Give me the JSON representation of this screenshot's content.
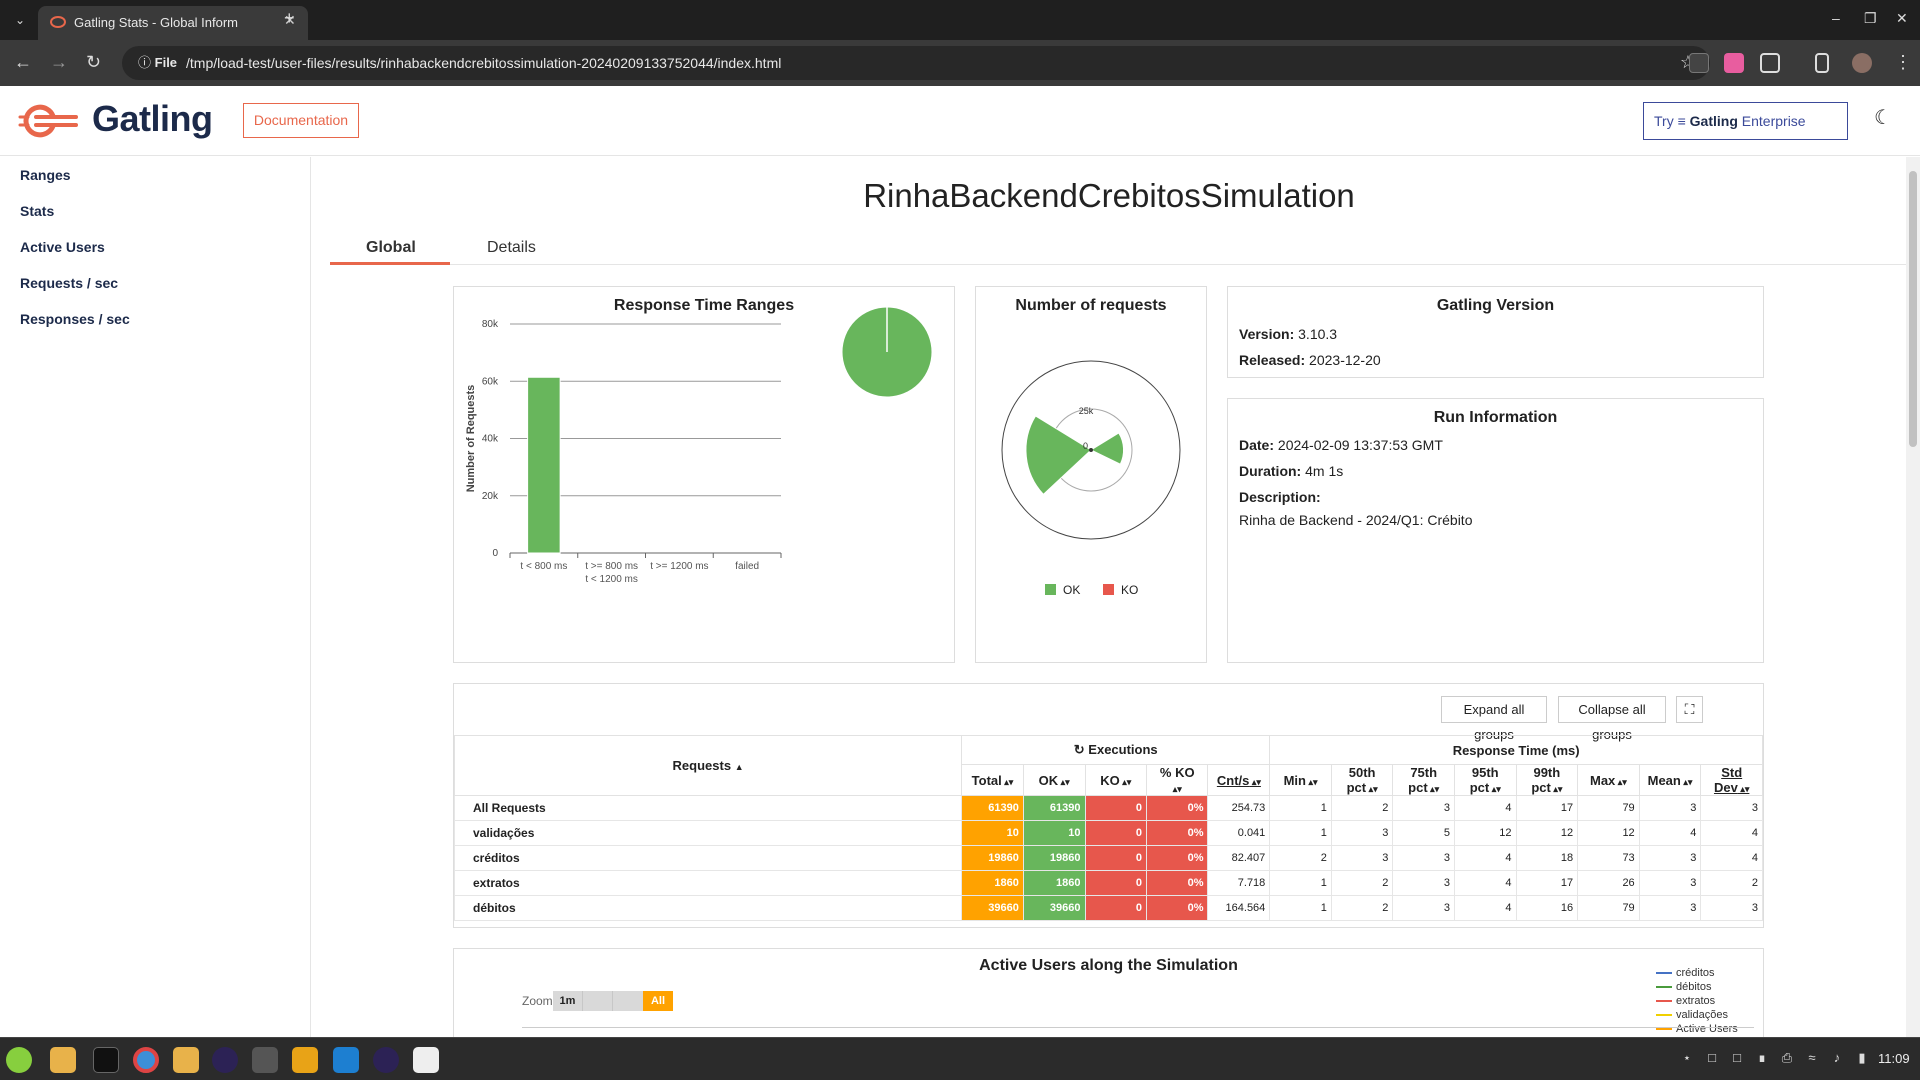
{
  "browser": {
    "tab_title": "Gatling Stats - Global Inform",
    "file_label": "File",
    "url": "/tmp/load-test/user-files/results/rinhabackendcrebitossimulation-20240209133752044/index.html",
    "icons": [
      "tab-menu-icon",
      "close-icon",
      "new-tab-icon",
      "back-icon",
      "forward-icon",
      "reload-icon",
      "info-icon",
      "star-icon",
      "extensions-icon",
      "sidebar-icon",
      "profile-avatar",
      "menu-icon"
    ]
  },
  "header": {
    "logo_text": "Gatling",
    "documentation_label": "Documentation",
    "enterprise_try": "Try",
    "enterprise_brand": "Gatling",
    "enterprise_suffix": "Enterprise"
  },
  "sidebar": {
    "items": [
      {
        "label": "Ranges"
      },
      {
        "label": "Stats"
      },
      {
        "label": "Active Users"
      },
      {
        "label": "Requests / sec"
      },
      {
        "label": "Responses / sec"
      }
    ]
  },
  "main": {
    "title": "RinhaBackendCrebitosSimulation",
    "tabs": [
      {
        "label": "Global"
      },
      {
        "label": "Details"
      }
    ]
  },
  "ranges_panel": {
    "title": "Response Time Ranges"
  },
  "requests_panel": {
    "title": "Number of requests",
    "legend_ok": "OK",
    "legend_ko": "KO"
  },
  "version_panel": {
    "title": "Gatling Version",
    "version_label": "Version:",
    "version": "3.10.3",
    "released_label": "Released:",
    "released": "2023-12-20"
  },
  "run_panel": {
    "title": "Run Information",
    "date_label": "Date:",
    "date": "2024-02-09 13:37:53 GMT",
    "duration_label": "Duration:",
    "duration": "4m 1s",
    "description_label": "Description:",
    "description": "Rinha de Backend - 2024/Q1: Crébito"
  },
  "stats_table": {
    "expand_label": "Expand all groups",
    "collapse_label": "Collapse all groups",
    "requests_header": "Requests",
    "executions_header": "Executions",
    "response_time_header": "Response Time (ms)",
    "columns": [
      "Total",
      "OK",
      "KO",
      "% KO",
      "Cnt/s",
      "Min",
      "50th pct",
      "75th pct",
      "95th pct",
      "99th pct",
      "Max",
      "Mean",
      "Std Dev"
    ],
    "col_split": {
      "pct_ko": [
        "% KO"
      ],
      "p50": [
        "50th",
        "pct"
      ],
      "p75": [
        "75th",
        "pct"
      ],
      "p95": [
        "95th",
        "pct"
      ],
      "p99": [
        "99th",
        "pct"
      ],
      "std": [
        "Std",
        "Dev"
      ]
    },
    "rows": [
      {
        "name": "All Requests",
        "total": "61390",
        "ok": "61390",
        "ko": "0",
        "pct_ko": "0%",
        "cnt": "254.73",
        "min": "1",
        "p50": "2",
        "p75": "3",
        "p95": "4",
        "p99": "17",
        "max": "79",
        "mean": "3",
        "std": "3"
      },
      {
        "name": "validações",
        "total": "10",
        "ok": "10",
        "ko": "0",
        "pct_ko": "0%",
        "cnt": "0.041",
        "min": "1",
        "p50": "3",
        "p75": "5",
        "p95": "12",
        "p99": "12",
        "max": "12",
        "mean": "4",
        "std": "4"
      },
      {
        "name": "créditos",
        "total": "19860",
        "ok": "19860",
        "ko": "0",
        "pct_ko": "0%",
        "cnt": "82.407",
        "min": "2",
        "p50": "3",
        "p75": "3",
        "p95": "4",
        "p99": "18",
        "max": "73",
        "mean": "3",
        "std": "4"
      },
      {
        "name": "extratos",
        "total": "1860",
        "ok": "1860",
        "ko": "0",
        "pct_ko": "0%",
        "cnt": "7.718",
        "min": "1",
        "p50": "2",
        "p75": "3",
        "p95": "4",
        "p99": "17",
        "max": "26",
        "mean": "3",
        "std": "2"
      },
      {
        "name": "débitos",
        "total": "39660",
        "ok": "39660",
        "ko": "0",
        "pct_ko": "0%",
        "cnt": "164.564",
        "min": "1",
        "p50": "2",
        "p75": "3",
        "p95": "4",
        "p99": "16",
        "max": "79",
        "mean": "3",
        "std": "3"
      }
    ]
  },
  "users_panel": {
    "title": "Active Users along the Simulation",
    "zoom_label": "Zoom",
    "zoom_options": [
      "1m",
      "",
      "",
      "All"
    ],
    "legend": [
      {
        "name": "créditos",
        "color": "#4572c4"
      },
      {
        "name": "débitos",
        "color": "#4a9b3c"
      },
      {
        "name": "extratos",
        "color": "#e7574c"
      },
      {
        "name": "validações",
        "color": "#f0d000"
      },
      {
        "name": "Active Users",
        "color": "#ffa200"
      }
    ]
  },
  "taskbar": {
    "clock": "11:09"
  },
  "chart_data": [
    {
      "type": "bar",
      "title": "Response Time Ranges",
      "ylabel": "Number of Requests",
      "categories": [
        "t < 800 ms",
        "t >= 800 ms\nt < 1200 ms",
        "t >= 1200 ms",
        "failed"
      ],
      "category_lines": [
        [
          "t < 800 ms"
        ],
        [
          "t >= 800 ms",
          "t < 1200 ms"
        ],
        [
          "t >= 1200 ms"
        ],
        [
          "failed"
        ]
      ],
      "values": [
        61390,
        0,
        0,
        0
      ],
      "colors": [
        "#68b65c",
        "#ffa200",
        "#e8674b",
        "#e7574c"
      ],
      "yticks": [
        "0",
        "20k",
        "40k",
        "60k",
        "80k"
      ],
      "ylim": [
        0,
        80000
      ],
      "inset_pie": {
        "values": [
          100,
          0
        ],
        "colors": [
          "#68b65c",
          "#e7574c"
        ]
      }
    },
    {
      "type": "pie",
      "title": "Number of requests",
      "subtype": "polar",
      "categories": [
        "validações",
        "créditos",
        "extratos",
        "débitos"
      ],
      "values": [
        10,
        19860,
        1860,
        39660
      ],
      "radial_ticks": [
        "0",
        "25k"
      ],
      "series": [
        {
          "name": "OK",
          "color": "#68b65c"
        },
        {
          "name": "KO",
          "color": "#e7574c"
        }
      ]
    }
  ]
}
